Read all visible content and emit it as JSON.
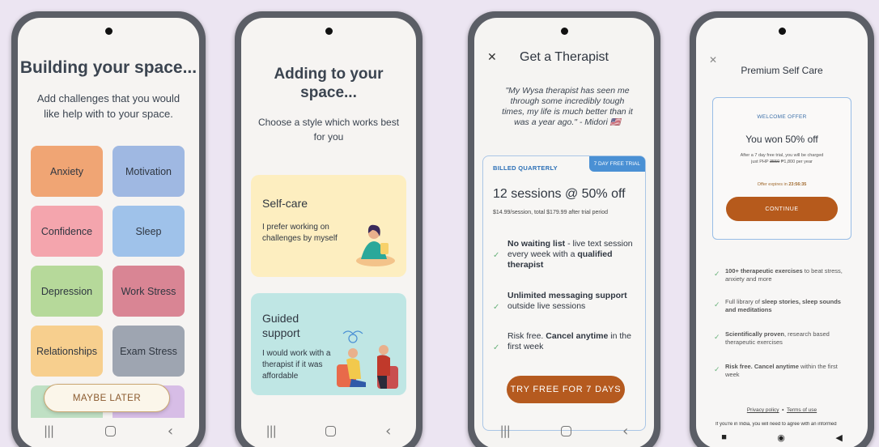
{
  "phone1": {
    "title": "Building your space...",
    "subtitle": "Add challenges that you would like help with to your space.",
    "tiles": [
      {
        "label": "Anxiety",
        "color": "#f0a574"
      },
      {
        "label": "Motivation",
        "color": "#9fb8e2"
      },
      {
        "label": "Confidence",
        "color": "#f4a5ad"
      },
      {
        "label": "Sleep",
        "color": "#9fc2ea"
      },
      {
        "label": "Depression",
        "color": "#b6d99a"
      },
      {
        "label": "Work Stress",
        "color": "#d98594"
      },
      {
        "label": "Relationships",
        "color": "#f7cf8e"
      },
      {
        "label": "Exam Stress",
        "color": "#9ea5b1"
      },
      {
        "label": "",
        "color": "#bfe0c4"
      },
      {
        "label": "",
        "color": "#d7bde6"
      }
    ],
    "maybe_later": "MAYBE LATER"
  },
  "phone2": {
    "title": "Adding to your space...",
    "subtitle": "Choose a style which works best for you",
    "card1": {
      "title": "Self-care",
      "desc": "I prefer working on challenges by myself",
      "color": "#fdeec0"
    },
    "card2": {
      "title": "Guided support",
      "desc": "I would work with a therapist if it was affordable",
      "color": "#bfe6e4"
    }
  },
  "phone3": {
    "title": "Get a Therapist",
    "quote": "\"My Wysa therapist has seen me through some incredibly tough times, my life is much better than it was a year ago.\" - Midori 🇺🇸",
    "plan_label": "BILLED QUARTERLY",
    "trial_badge": "7 DAY FREE TRIAL",
    "plan_head": "12 sessions @ 50% off",
    "plan_price": "$14.99/session, total $179.99 after trial period",
    "features": [
      {
        "bold1": "No waiting list",
        "text": " - live text session every week with a ",
        "bold2": "qualified therapist"
      },
      {
        "bold1": "Unlimited messaging support",
        "text": " outside live sessions",
        "bold2": ""
      },
      {
        "bold1": "",
        "text": "Risk free. ",
        "bold2": "Cancel anytime",
        "tail": " in the first week"
      }
    ],
    "cta": "TRY FREE FOR 7 DAYS"
  },
  "phone4": {
    "title": "Premium Self Care",
    "offer_label": "WELCOME OFFER",
    "offer_head": "You won 50% off",
    "offer_desc_1": "After a 7 day free trial, you will be charged",
    "offer_desc_2a": "just PHP ",
    "offer_desc_old": "3550",
    "offer_desc_2b": " ₱1,800 per year",
    "expires_prefix": "Offer expires in ",
    "expires_time": "23:56:35",
    "cta": "CONTINUE",
    "features": [
      {
        "bold": "100+ therapeutic exercises",
        "text": " to beat stress, anxiety and more"
      },
      {
        "pre": "Full library of ",
        "bold": "sleep stories, sleep sounds and meditations",
        "text": ""
      },
      {
        "bold": "Scientifically proven",
        "text": ", research based therapeutic exercises"
      },
      {
        "bold": "Risk free. Cancel anytime",
        "text": " within the first week"
      }
    ],
    "privacy": "Privacy policy",
    "separator": "•",
    "terms": "Terms of use",
    "india_note": "If you're in India, you will need to agree with an informed"
  },
  "nav": {
    "recent": "|||",
    "back": "‹"
  },
  "nav4": {
    "recent": "■",
    "home": "◉",
    "back": "◀"
  }
}
